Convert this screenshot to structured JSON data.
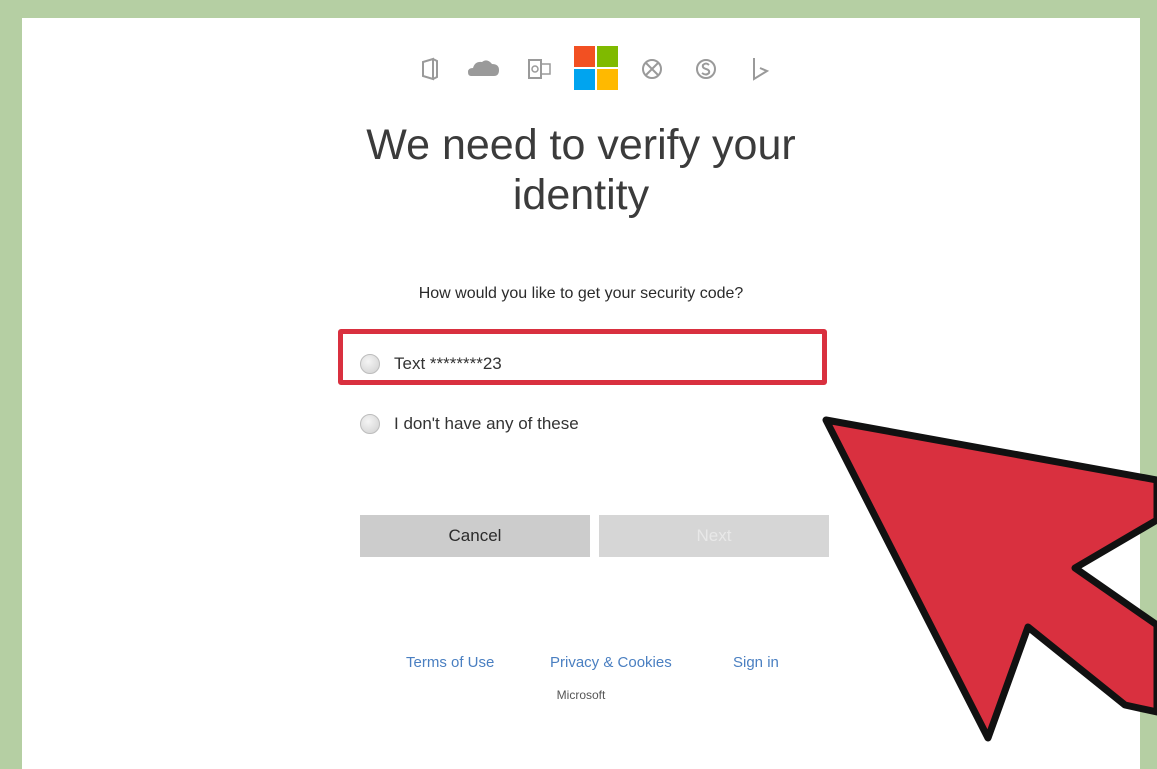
{
  "product_icons": [
    {
      "name": "office-icon",
      "color": "#9a9a9a"
    },
    {
      "name": "onedrive-icon",
      "color": "#9a9a9a"
    },
    {
      "name": "outlook-icon",
      "color": "#9a9a9a"
    },
    {
      "name": "microsoft-logo-icon",
      "colors": [
        "#f25022",
        "#7fba00",
        "#00a4ef",
        "#ffb900"
      ]
    },
    {
      "name": "xbox-icon",
      "color": "#9a9a9a"
    },
    {
      "name": "skype-icon",
      "color": "#9a9a9a"
    },
    {
      "name": "bing-icon",
      "color": "#9a9a9a"
    }
  ],
  "heading": {
    "line1": "We need to verify your",
    "line2": "identity"
  },
  "question": "How would you like to get your security code?",
  "options": [
    {
      "label": "Text ********23",
      "selected": false,
      "highlighted": true
    },
    {
      "label": "I don't have any of these",
      "selected": false
    }
  ],
  "buttons": {
    "cancel": "Cancel",
    "next": "Next"
  },
  "footer": {
    "terms": "Terms of Use",
    "privacy": "Privacy & Cookies",
    "signin": "Sign in",
    "brand": "Microsoft"
  },
  "colors": {
    "highlight": "#d9303f",
    "arrow": "#d9303f",
    "link": "#4a7fc1",
    "frame": "#b5cfa3"
  }
}
